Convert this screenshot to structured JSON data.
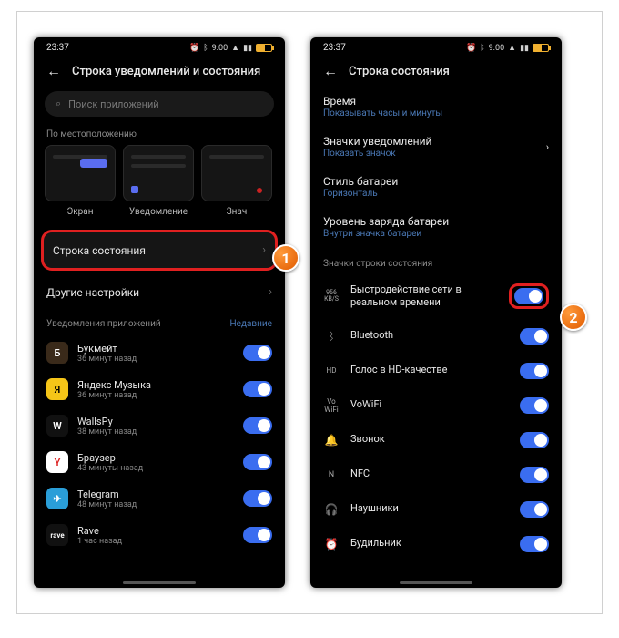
{
  "statusbar": {
    "time": "23:37",
    "net": "9.00",
    "net_unit": "KB/S"
  },
  "left": {
    "title": "Строка уведомлений и состояния",
    "search_placeholder": "Поиск приложений",
    "sec_location": "По местоположению",
    "tiles": {
      "t1": "Экран",
      "t2": "Уведомление",
      "t3": "Знач"
    },
    "row_status_bar": "Строка состояния",
    "row_other": "Другие настройки",
    "group_notif": "Уведомления приложений",
    "group_recent": "Недавние",
    "apps": [
      {
        "name": "Букмейт",
        "sub": "36 минут назад"
      },
      {
        "name": "Яндекс Музыка",
        "sub": "36 минут назад"
      },
      {
        "name": "WallsPy",
        "sub": "38 минут назад"
      },
      {
        "name": "Браузер",
        "sub": "43 минуты назад"
      },
      {
        "name": "Telegram",
        "sub": "48 минут назад"
      },
      {
        "name": "Rave",
        "sub": "1 час назад"
      }
    ]
  },
  "right": {
    "title": "Строка состояния",
    "rows": [
      {
        "t": "Время",
        "s": "Показывать часы и минуты"
      },
      {
        "t": "Значки уведомлений",
        "s": "Показать значок"
      },
      {
        "t": "Стиль батареи",
        "s": "Горизонталь"
      },
      {
        "t": "Уровень заряда батареи",
        "s": "Внутри значка батареи"
      }
    ],
    "sec_icons": "Значки строки состояния",
    "items": [
      {
        "ic": "956\nKB/S",
        "label": "Быстродействие сети в реальном времени"
      },
      {
        "ic": "bt",
        "label": "Bluetooth"
      },
      {
        "ic": "hd",
        "label": "Голос в HD-качестве"
      },
      {
        "ic": "vw",
        "label": "VoWiFi"
      },
      {
        "ic": "bell",
        "label": "Звонок"
      },
      {
        "ic": "nfc",
        "label": "NFC"
      },
      {
        "ic": "hp",
        "label": "Наушники"
      },
      {
        "ic": "alarm",
        "label": "Будильник"
      }
    ]
  },
  "callouts": {
    "c1": "1",
    "c2": "2"
  }
}
